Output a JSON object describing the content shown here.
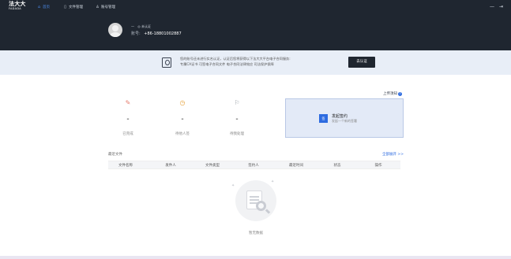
{
  "brand": {
    "name_cn": "法大大",
    "name_en": "FADADA"
  },
  "nav": [
    {
      "label": "首页",
      "icon": "home-icon",
      "active": true
    },
    {
      "label": "文件管理",
      "icon": "file-icon",
      "active": false
    },
    {
      "label": "账号管理",
      "icon": "user-icon",
      "active": false
    }
  ],
  "topright": {
    "minimize_glyph": "—",
    "logout_glyph": "⇥"
  },
  "profile": {
    "name": "—",
    "status": "未认证",
    "phone_label": "账号:",
    "phone": "+86-18801002887"
  },
  "banner": {
    "line1": "您的账号还未进行实名认证，认证后您将获得以下法大大平台电子合同服务:",
    "line2": "专属CA证书  可签电子合同文件  电子合同法律效应  司法保护保障",
    "button": "去认证"
  },
  "stats": [
    {
      "label": "已完成",
      "value": "–",
      "icon": "pen-icon"
    },
    {
      "label": "待他人签",
      "value": "–",
      "icon": "clock-icon"
    },
    {
      "label": "待我处理",
      "value": "–",
      "icon": "flag-icon"
    }
  ],
  "upload": {
    "label": "上传须知",
    "help": "?"
  },
  "start_card": {
    "badge": "签",
    "title": "发起签约",
    "subtitle": "发起一个新的签署"
  },
  "recent": {
    "title": "最近文件",
    "view_all": "全部展开 >>",
    "columns": [
      "文件名称",
      "发件人",
      "文件类型",
      "签约人",
      "最近时间",
      "状态",
      "操作"
    ]
  },
  "empty": {
    "text": "暂无数据"
  },
  "colors": {
    "dark": "#1f2630",
    "accent": "#2d6be0",
    "banner_bg": "#e8eef7"
  }
}
